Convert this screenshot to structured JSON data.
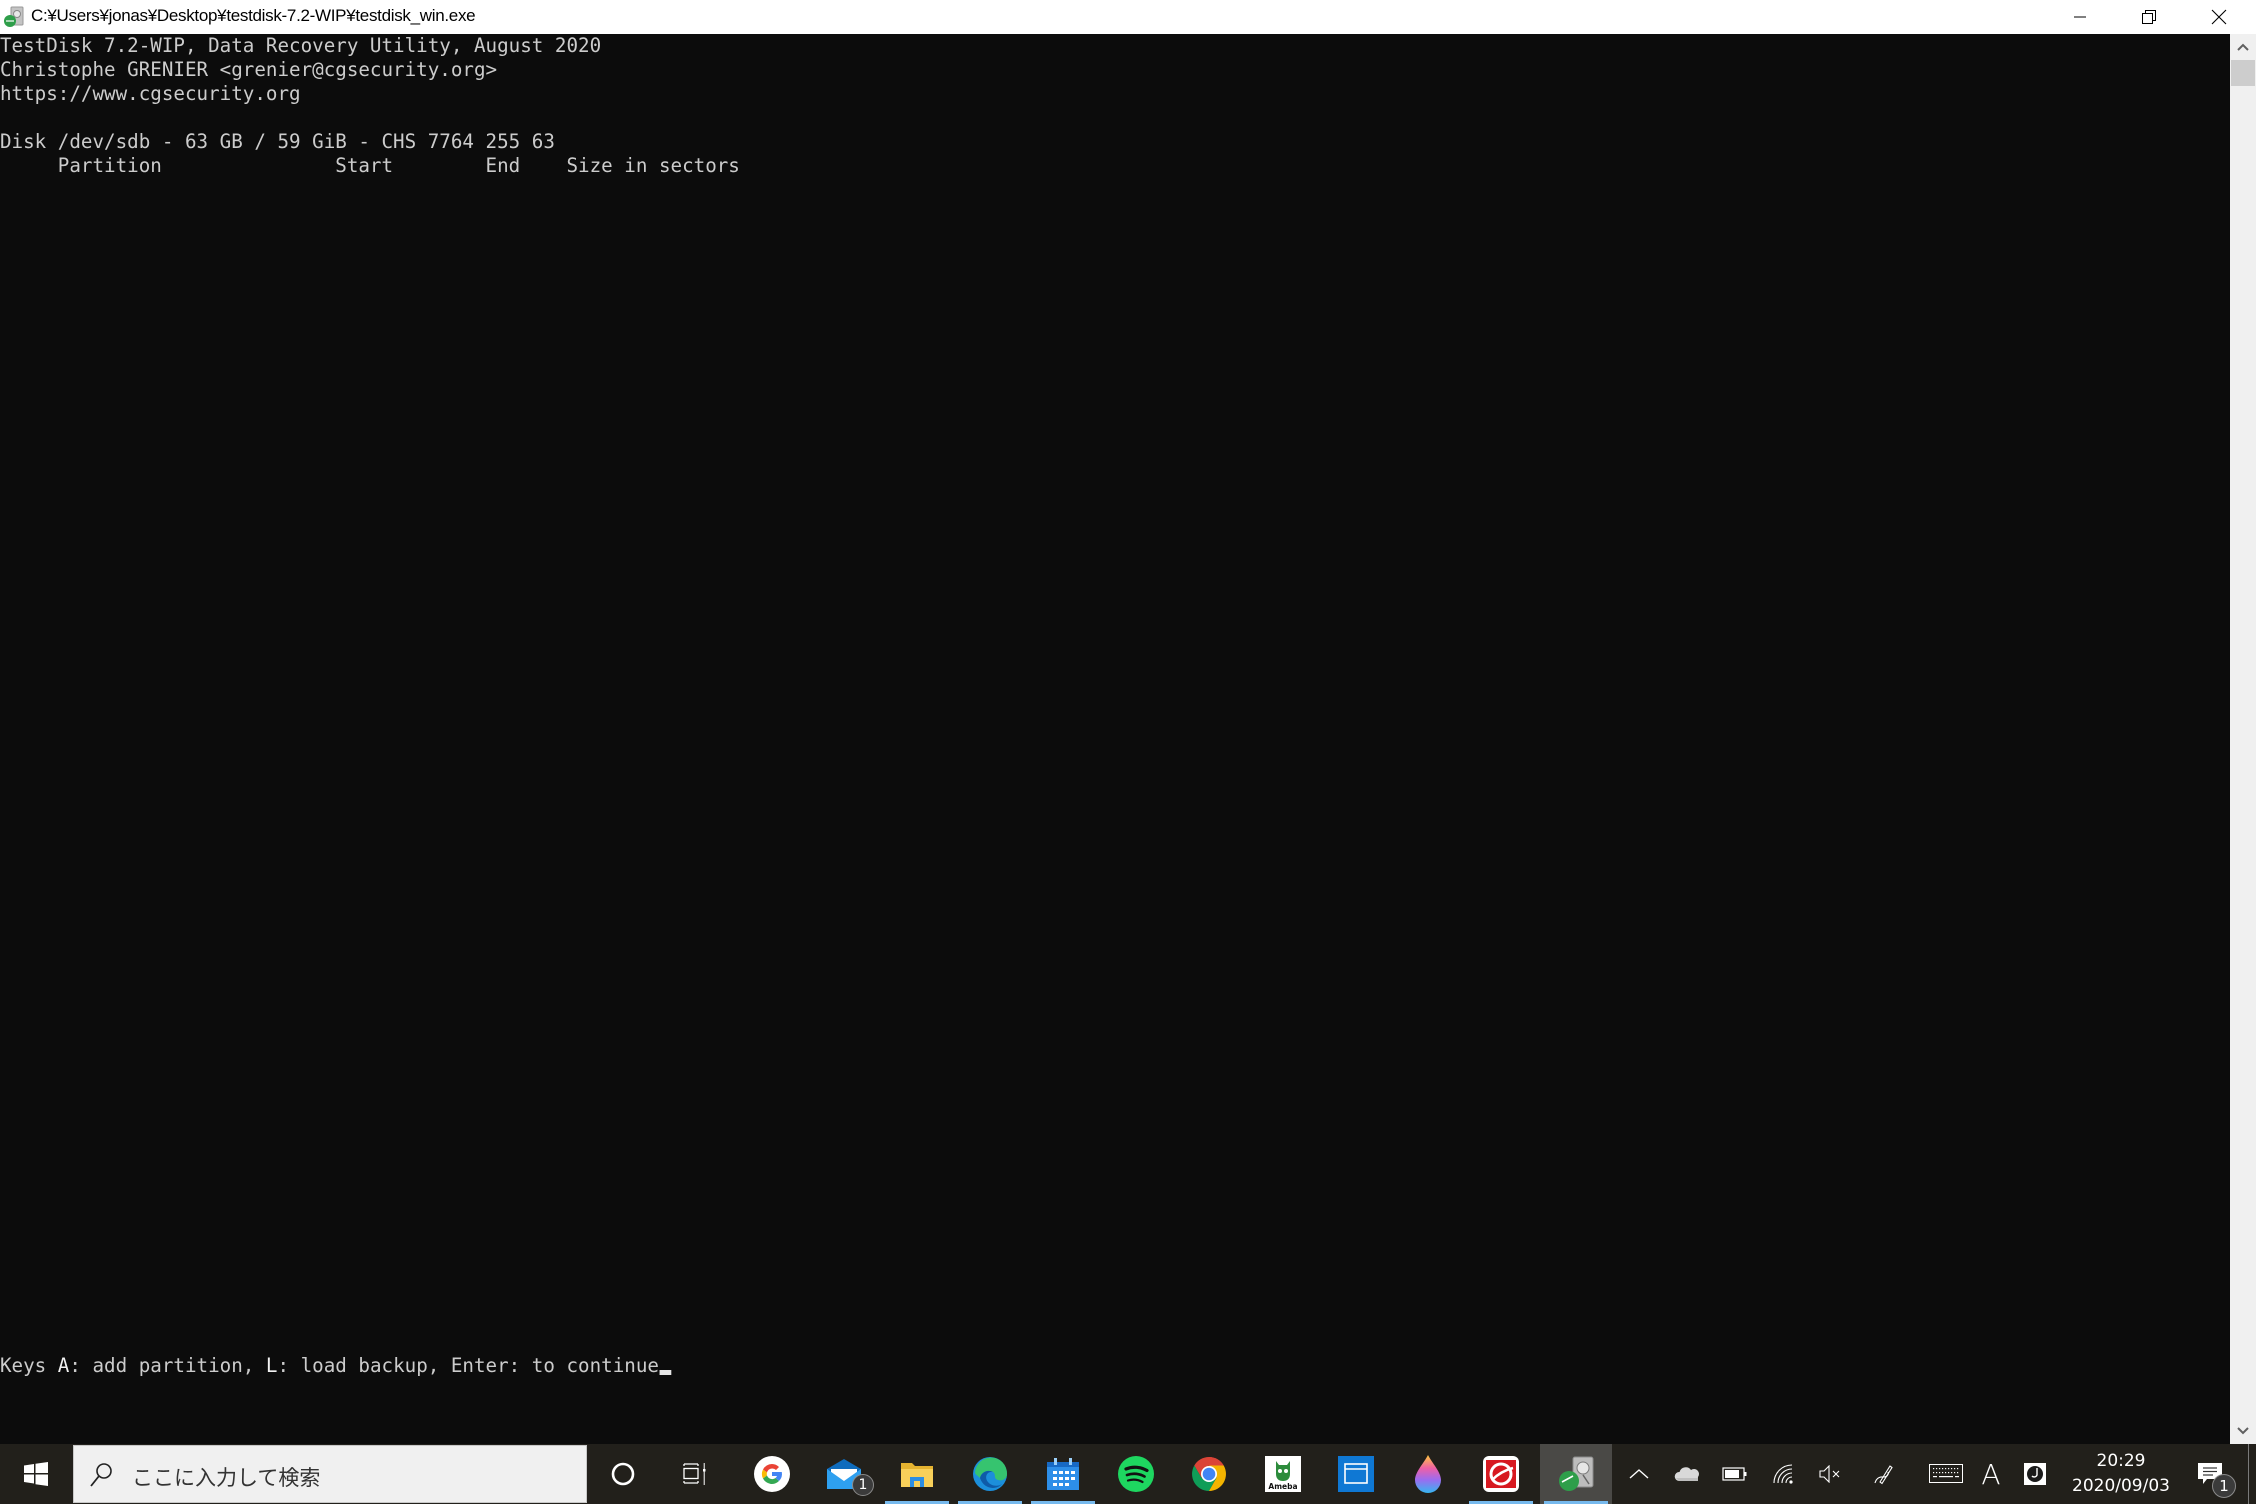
{
  "window": {
    "title": "C:¥Users¥jonas¥Desktop¥testdisk-7.2-WIP¥testdisk_win.exe",
    "app_icon": "testdisk-icon",
    "controls": {
      "minimize": "minimize-icon",
      "maximize": "restore-icon",
      "close": "close-icon"
    }
  },
  "console": {
    "lines": [
      "TestDisk 7.2-WIP, Data Recovery Utility, August 2020",
      "Christophe GRENIER <grenier@cgsecurity.org>",
      "https://www.cgsecurity.org",
      "",
      "Disk /dev/sdb - 63 GB / 59 GiB - CHS 7764 255 63",
      "     Partition               Start        End    Size in sectors"
    ],
    "prompt": {
      "prefix": "Keys ",
      "key_a": "A",
      "after_a": ": add partition, ",
      "key_l": "L",
      "after_l": ": load backup, Enter: to continue"
    }
  },
  "taskbar": {
    "start": "windows-start-icon",
    "search_placeholder": "ここに入力して検索",
    "pinned_apps": [
      {
        "name": "cortana",
        "icon": "cortana-icon"
      },
      {
        "name": "task-view",
        "icon": "task-view-icon"
      },
      {
        "name": "google",
        "icon": "google-icon"
      },
      {
        "name": "mail",
        "icon": "mail-icon",
        "badge": "1"
      },
      {
        "name": "file-explorer",
        "icon": "folder-icon",
        "running": true
      },
      {
        "name": "edge",
        "icon": "edge-icon",
        "running": true
      },
      {
        "name": "calendar",
        "icon": "calendar-icon",
        "running": true
      },
      {
        "name": "spotify",
        "icon": "spotify-icon"
      },
      {
        "name": "chrome",
        "icon": "chrome-icon"
      },
      {
        "name": "ameba",
        "icon": "ameba-icon",
        "label": "Ameba"
      },
      {
        "name": "app-window",
        "icon": "window-app-icon"
      },
      {
        "name": "paint-3d",
        "icon": "paint-drop-icon"
      },
      {
        "name": "trend-micro",
        "icon": "trend-micro-icon",
        "running": true
      },
      {
        "name": "testdisk",
        "icon": "testdisk-icon",
        "running": true,
        "active": true
      }
    ],
    "tray": {
      "icons": [
        "chevron-up-icon",
        "onedrive-icon",
        "battery-icon",
        "wifi-icon",
        "volume-muted-icon",
        "pen-icon",
        "touch-keyboard-icon",
        "ime-icon",
        "j-app-icon"
      ],
      "ime_label": "A",
      "time": "20:29",
      "date": "2020/09/03",
      "notification_count": "1"
    }
  }
}
